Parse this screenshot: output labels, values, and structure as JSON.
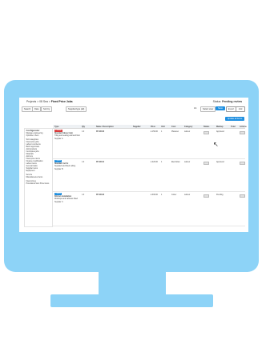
{
  "header": {
    "breadcrumb_prefix": "Projects > 08 Sea >",
    "breadcrumb_current": "Fixed Price Jobs",
    "status_label": "Status:",
    "status_value": "Pending review"
  },
  "filters": {
    "search": "Search",
    "date": "Date",
    "status_chip": "Sort by",
    "supplier_chip": "Supplier/type (all)",
    "count": "1/1",
    "view_label": "Select view",
    "btn_save": "Save",
    "btn_export": "Export",
    "btn_add": "Add",
    "btn_update": "Update all items"
  },
  "sidebar": {
    "title": "Configurator",
    "items": [
      "Manage engineering",
      "Optimise  1 item",
      "Sort categories",
      "Fixed price jobs",
      "Labour cost items",
      "Batch approvals",
      "Add products",
      "Incomplete jobs",
      "Materials",
      "Add ons",
      "Fixed price items",
      "Finance modification",
      "Labour items",
      "General tasks",
      "Supplier items",
      "Equipment",
      "Service",
      "Miscellaneous  Items",
      "Fixed prices",
      "Provisional Sum Price Items"
    ]
  },
  "table": {
    "columns": [
      "Type",
      "Qty",
      "Name / Description",
      "Supplier",
      "Price",
      "Unit",
      "Cost",
      "Category",
      "Status",
      "Markup",
      "Total",
      "Actions"
    ],
    "rows": [
      {
        "tag": "Priority",
        "tag_color": "#d93b3b",
        "name": "Standard labour item",
        "desc": "Tiling and sealing wall and floor",
        "sub": "Supplier A",
        "code": "FP-00140",
        "qty": "1.0",
        "price": "£ 150.00",
        "unit": "1",
        "cost": "Plasterer",
        "cat": "Labour",
        "status": "Approved"
      },
      {
        "tag": "Option",
        "tag_color": "#1e8fe0",
        "name": "Standard 1st fix",
        "desc": "Supplied and fitted ceiling",
        "sub": "Supplier B",
        "code": "FP-00141",
        "qty": "1.0",
        "price": "£ 220.00",
        "unit": "1",
        "cost": "Electrician",
        "cat": "Labour",
        "status": "Approved"
      },
      {
        "tag": "Option",
        "tag_color": "#1e8fe0",
        "name": "Kitchen installation",
        "desc": "Worktops and cabinets fitted",
        "sub": "Supplier C",
        "code": "FP-00142",
        "qty": "1.0",
        "price": "£ 300.00",
        "unit": "1",
        "cost": "Joiner",
        "cat": "Labour",
        "status": "Pending"
      }
    ]
  }
}
